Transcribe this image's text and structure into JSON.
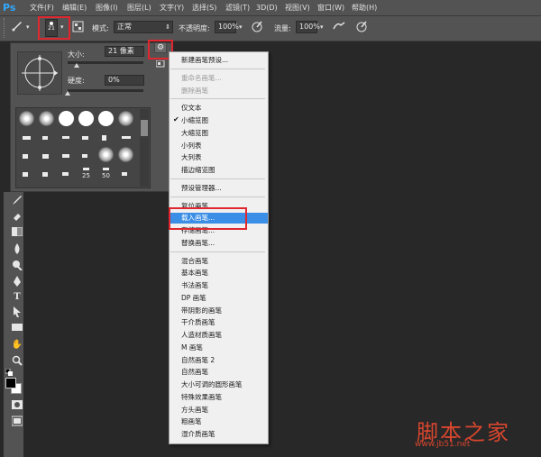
{
  "menubar": {
    "logo": "Ps",
    "items": [
      "文件(F)",
      "编辑(E)",
      "图像(I)",
      "图层(L)",
      "文字(Y)",
      "选择(S)",
      "滤镜(T)",
      "3D(D)",
      "视图(V)",
      "窗口(W)",
      "帮助(H)"
    ]
  },
  "options": {
    "brush_size_preview": "21",
    "mode_label": "模式:",
    "mode_value": "正常",
    "opacity_label": "不透明度:",
    "opacity_value": "100%",
    "flow_label": "流量:",
    "flow_value": "100%"
  },
  "picker": {
    "size_label": "大小:",
    "size_value": "21 像素",
    "hardness_label": "硬度:",
    "hardness_value": "0%",
    "size_slider_level": 0.12,
    "hardness_slider_level": 0.0,
    "brush_numbers": [
      "25",
      "50"
    ]
  },
  "context_menu": {
    "items": [
      {
        "label": "新建画笔预设...",
        "disabled": false
      },
      {
        "sep": true
      },
      {
        "label": "重命名画笔...",
        "disabled": true
      },
      {
        "label": "删除画笔",
        "disabled": true
      },
      {
        "sep": true
      },
      {
        "label": "仅文本",
        "disabled": false
      },
      {
        "label": "小缩览图",
        "disabled": false,
        "checked": true
      },
      {
        "label": "大缩览图",
        "disabled": false
      },
      {
        "label": "小列表",
        "disabled": false
      },
      {
        "label": "大列表",
        "disabled": false
      },
      {
        "label": "描边缩览图",
        "disabled": false
      },
      {
        "sep": true
      },
      {
        "label": "预设管理器...",
        "disabled": false
      },
      {
        "sep": true
      },
      {
        "label": "复位画笔...",
        "disabled": false
      },
      {
        "label": "载入画笔...",
        "disabled": false,
        "highlighted": true
      },
      {
        "label": "存储画笔...",
        "disabled": false
      },
      {
        "label": "替换画笔...",
        "disabled": false
      },
      {
        "sep": true
      },
      {
        "label": "混合画笔",
        "disabled": false
      },
      {
        "label": "基本画笔",
        "disabled": false
      },
      {
        "label": "书法画笔",
        "disabled": false
      },
      {
        "label": "DP 画笔",
        "disabled": false
      },
      {
        "label": "带阴影的画笔",
        "disabled": false
      },
      {
        "label": "干介质画笔",
        "disabled": false
      },
      {
        "label": "人造材质画笔",
        "disabled": false
      },
      {
        "label": "M 画笔",
        "disabled": false
      },
      {
        "label": "自然画笔 2",
        "disabled": false
      },
      {
        "label": "自然画笔",
        "disabled": false
      },
      {
        "label": "大小可调的圆形画笔",
        "disabled": false
      },
      {
        "label": "特殊效果画笔",
        "disabled": false
      },
      {
        "label": "方头画笔",
        "disabled": false
      },
      {
        "label": "粗画笔",
        "disabled": false
      },
      {
        "label": "湿介质画笔",
        "disabled": false
      }
    ]
  },
  "watermark": {
    "text": "脚本之家",
    "url": "www.jb51.net"
  },
  "colors": {
    "accent_highlight": "#3a8ee6",
    "annotation_red": "#e0262e",
    "watermark": "#d8462e"
  }
}
